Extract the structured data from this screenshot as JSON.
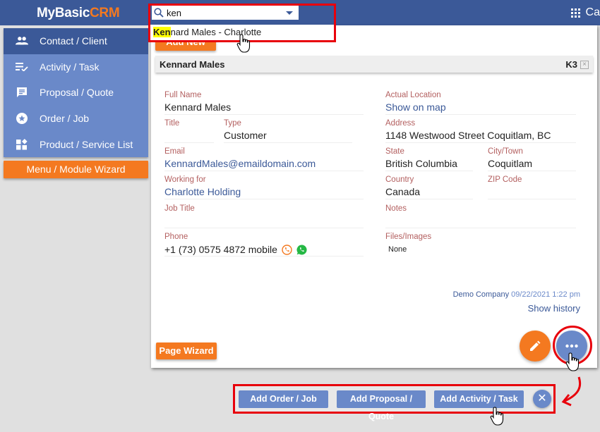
{
  "app": {
    "logo_part1": "MyBasic",
    "logo_part2": "CRM",
    "apps_label": "Ca"
  },
  "search": {
    "value": "ken",
    "placeholder": "",
    "result_highlight": "Ken",
    "result_rest": "nard Males - Charlotte"
  },
  "sidebar": {
    "items": [
      {
        "label": "Contact / Client",
        "icon": "people-icon",
        "active": true
      },
      {
        "label": "Activity / Task",
        "icon": "checklist-icon",
        "active": false
      },
      {
        "label": "Proposal / Quote",
        "icon": "comment-icon",
        "active": false
      },
      {
        "label": "Order / Job",
        "icon": "star-circle-icon",
        "active": false
      },
      {
        "label": "Product / Service List",
        "icon": "widgets-icon",
        "active": false
      }
    ],
    "wizard_label": "Menu / Module Wizard"
  },
  "record": {
    "add_new_label": "Add New",
    "header_name": "Kennard Males",
    "code": "K3",
    "close_glyph": "×",
    "fields": {
      "full_name": {
        "label": "Full Name",
        "value": "Kennard Males"
      },
      "title": {
        "label": "Title",
        "value": ""
      },
      "type": {
        "label": "Type",
        "value": "Customer"
      },
      "email": {
        "label": "Email",
        "value": "KennardMales@emaildomain.com"
      },
      "working_for": {
        "label": "Working for",
        "value": "Charlotte Holding"
      },
      "job_title": {
        "label": "Job Title",
        "value": ""
      },
      "phone": {
        "label": "Phone",
        "value": "+1 (73) 0575 4872 mobile"
      },
      "actual_location": {
        "label": "Actual Location",
        "value": "Show on map"
      },
      "address": {
        "label": "Address",
        "value": "1148 Westwood Street Coquitlam, BC"
      },
      "state": {
        "label": "State",
        "value": "British Columbia"
      },
      "city": {
        "label": "City/Town",
        "value": "Coquitlam"
      },
      "country": {
        "label": "Country",
        "value": "Canada"
      },
      "zip": {
        "label": "ZIP Code",
        "value": ""
      },
      "notes": {
        "label": "Notes",
        "value": ""
      },
      "files": {
        "label": "Files/Images",
        "value": "None"
      }
    },
    "meta_company": "Demo Company",
    "meta_date": "09/22/2021 1:22 pm",
    "show_history": "Show history",
    "page_wizard_label": "Page Wizard"
  },
  "actions": {
    "buttons": [
      "Add Order / Job",
      "Add Proposal / Quote",
      "Add Activity / Task"
    ],
    "close_glyph": "✕"
  },
  "colors": {
    "primary": "#3b5998",
    "secondary": "#6a89c9",
    "accent": "#f47920",
    "label": "#b35f5f",
    "annotation": "#e8000b"
  }
}
